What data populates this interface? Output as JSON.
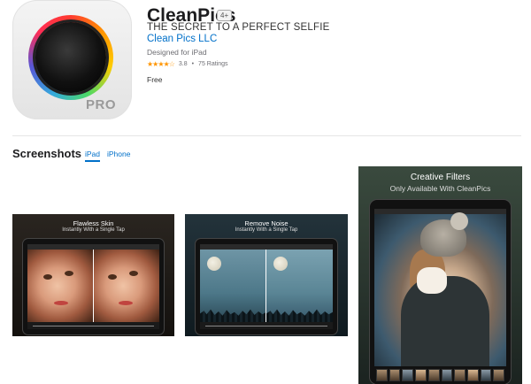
{
  "app": {
    "title": "CleanPics",
    "age_rating": "4+",
    "subtitle": "THE SECRET TO A PERFECT SELFIE",
    "developer": "Clean Pics LLC",
    "designed_for": "Designed for iPad",
    "rating_stars": "★★★★☆",
    "rating_value": "3.8",
    "rating_separator": "•",
    "rating_count": "75 Ratings",
    "price": "Free",
    "icon_badge": "PRO",
    "icon": "camera-lens-icon"
  },
  "screenshots": {
    "title": "Screenshots",
    "tabs": [
      {
        "label": "iPad",
        "selected": true
      },
      {
        "label": "iPhone",
        "selected": false
      }
    ],
    "cards": [
      {
        "caption": "Flawless Skin",
        "subcaption": "Instantly With a Single Tap"
      },
      {
        "caption": "Remove Noise",
        "subcaption": "Instantly With a Single Tap"
      },
      {
        "caption": "Creative Filters",
        "subcaption": "Only Available With CleanPics"
      }
    ]
  },
  "colors": {
    "link": "#0070c9",
    "stars": "#ff9500",
    "text": "#1d1d1f",
    "muted": "#6e6e73"
  }
}
